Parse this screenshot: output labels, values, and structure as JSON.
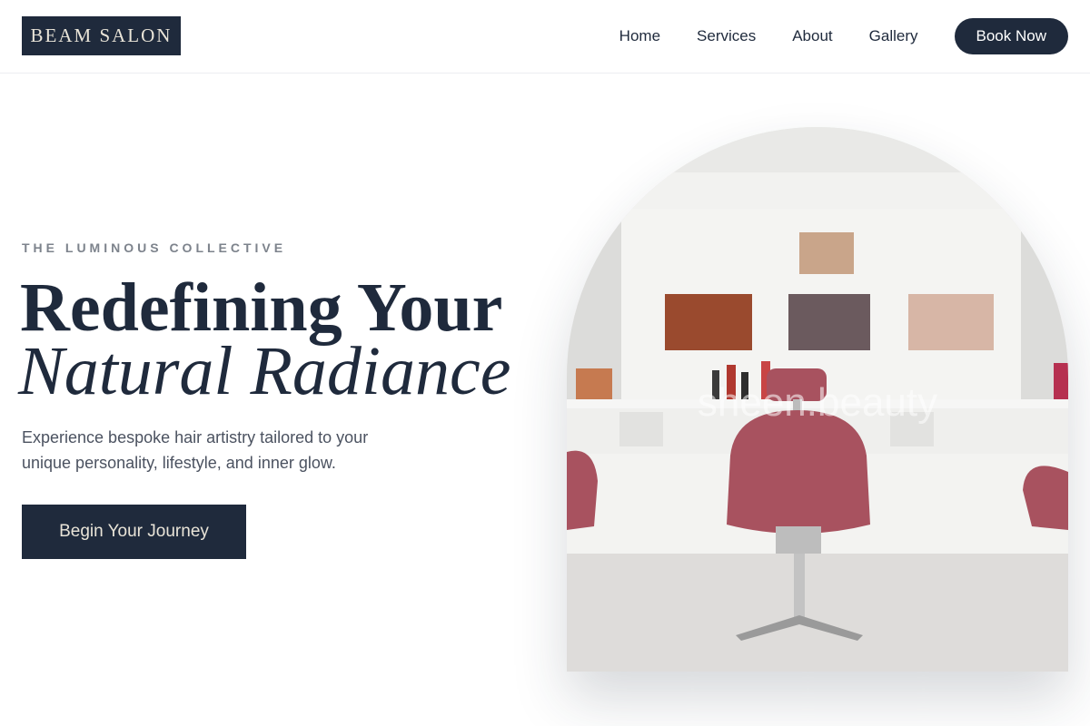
{
  "header": {
    "logo": "BEAM SALON",
    "nav": [
      "Home",
      "Services",
      "About",
      "Gallery"
    ],
    "book_button": "Book Now"
  },
  "hero": {
    "eyebrow": "THE LUMINOUS COLLECTIVE",
    "title_line1": "Redefining Your",
    "title_line2": "Natural Radiance",
    "description": "Experience bespoke hair artistry tailored to your unique personality, lifestyle, and inner glow.",
    "cta": "Begin Your Journey",
    "image_watermark": "sheen.beauty"
  },
  "colors": {
    "navy": "#1f2a3c",
    "cream": "#e9e4d8",
    "chair": "#a8525f",
    "muted": "#7d838c"
  }
}
